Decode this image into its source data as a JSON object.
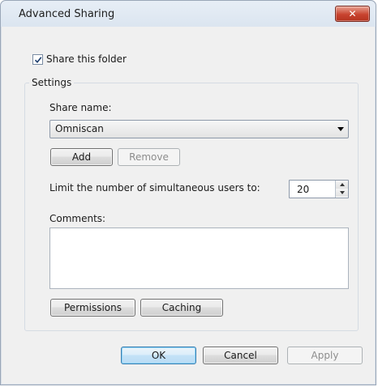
{
  "window": {
    "title": "Advanced Sharing",
    "close_glyph": "✕"
  },
  "share": {
    "checkbox_label": "Share this folder",
    "checked": true
  },
  "settings": {
    "group_label": "Settings",
    "share_name_label": "Share name:",
    "share_name_value": "Omniscan",
    "add_label": "Add",
    "remove_label": "Remove",
    "limit_label": "Limit the number of simultaneous users to:",
    "limit_value": "20",
    "comments_label": "Comments:",
    "comments_value": "",
    "permissions_label": "Permissions",
    "caching_label": "Caching"
  },
  "footer": {
    "ok_label": "OK",
    "cancel_label": "Cancel",
    "apply_label": "Apply"
  },
  "icons": {
    "close": "close-icon",
    "check": "checkmark-icon",
    "dropdown": "chevron-down-icon",
    "spin_up": "arrow-up-icon",
    "spin_down": "arrow-down-icon"
  },
  "colors": {
    "close_button": "#c8442f",
    "dialog_bg": "#f0f0f0",
    "default_button_border": "#3c7fb1"
  }
}
